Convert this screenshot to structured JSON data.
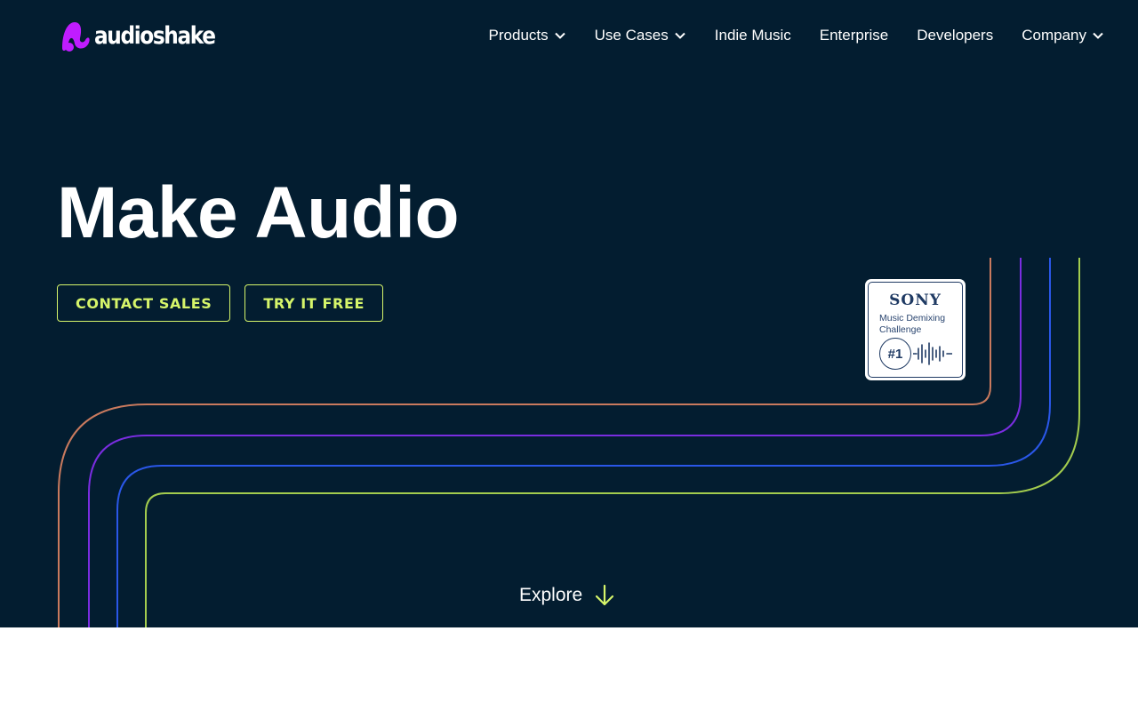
{
  "brand": {
    "name": "audioshake",
    "accent": "#c01cff"
  },
  "nav": {
    "items": [
      {
        "label": "Products",
        "has_dropdown": true
      },
      {
        "label": "Use Cases",
        "has_dropdown": true
      },
      {
        "label": "Indie Music",
        "has_dropdown": false
      },
      {
        "label": "Enterprise",
        "has_dropdown": false
      },
      {
        "label": "Developers",
        "has_dropdown": false
      },
      {
        "label": "Company",
        "has_dropdown": true
      }
    ]
  },
  "hero": {
    "headline": "Make Audio",
    "buttons": {
      "contact": "CONTACT SALES",
      "try": "TRY IT FREE"
    },
    "explore": "Explore",
    "background": "#031d30",
    "button_color": "#d6f56a",
    "line_colors": [
      "#c97a5e",
      "#7a2de0",
      "#2a57e8",
      "#a3cc4e"
    ]
  },
  "badge": {
    "brand": "SONY",
    "line1": "Music Demixing",
    "line2": "Challenge",
    "rank": "#1"
  },
  "icons": {
    "logo": "audioshake-logo-icon",
    "dropdown": "chevron-down-icon",
    "explore": "arrow-down-icon",
    "badge_wave": "waveform-icon"
  }
}
